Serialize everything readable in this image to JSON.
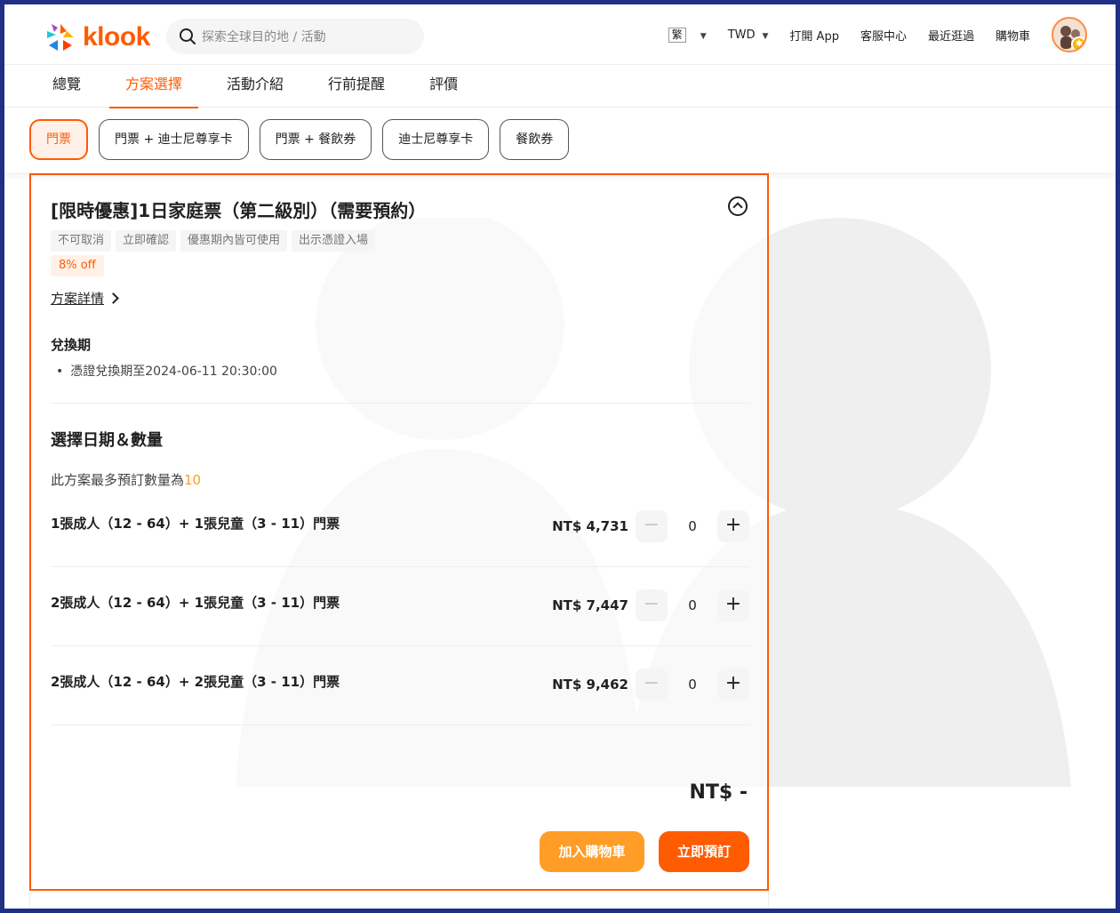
{
  "brand": {
    "name": "klook",
    "accent": "#ff5b00"
  },
  "header": {
    "search_placeholder": "探索全球目的地 / 活動",
    "lang": "繁",
    "currency": "TWD",
    "open_app": "打開 App",
    "help_center": "客服中心",
    "recently_viewed": "最近逛過",
    "cart": "購物車"
  },
  "tabs": [
    {
      "label": "總覽"
    },
    {
      "label": "方案選擇",
      "active": true
    },
    {
      "label": "活動介紹"
    },
    {
      "label": "行前提醒"
    },
    {
      "label": "評價"
    }
  ],
  "package_chips": [
    {
      "label": "門票",
      "active": true
    },
    {
      "label": "門票 + 迪士尼尊享卡"
    },
    {
      "label": "門票 + 餐飲券"
    },
    {
      "label": "迪士尼尊享卡"
    },
    {
      "label": "餐飲券"
    }
  ],
  "package": {
    "title": "[限時優惠]1日家庭票（第二級別）（需要預約）",
    "tags": [
      "不可取消",
      "立即確認",
      "優惠期內皆可使用",
      "出示憑證入場"
    ],
    "discount": "8% off",
    "details_link": "方案詳情",
    "redeem_heading": "兌換期",
    "redeem_item": "憑證兌換期至2024-06-11 20:30:00",
    "select_heading": "選擇日期＆數量",
    "limit_text": "此方案最多預訂數量為",
    "limit_value": "10",
    "units": [
      {
        "name": "1張成人（12 - 64）+ 1張兒童（3 - 11）門票",
        "price": "NT$ 4,731",
        "qty": "0",
        "minus": "−",
        "plus": "+"
      },
      {
        "name": "2張成人（12 - 64）+ 1張兒童（3 - 11）門票",
        "price": "NT$ 7,447",
        "qty": "0",
        "minus": "−",
        "plus": "+"
      },
      {
        "name": "2張成人（12 - 64）+ 2張兒童（3 - 11）門票",
        "price": "NT$ 9,462",
        "qty": "0",
        "minus": "−",
        "plus": "+"
      }
    ],
    "total": "NT$ -",
    "add_to_cart": "加入購物車",
    "book_now": "立即預訂"
  }
}
